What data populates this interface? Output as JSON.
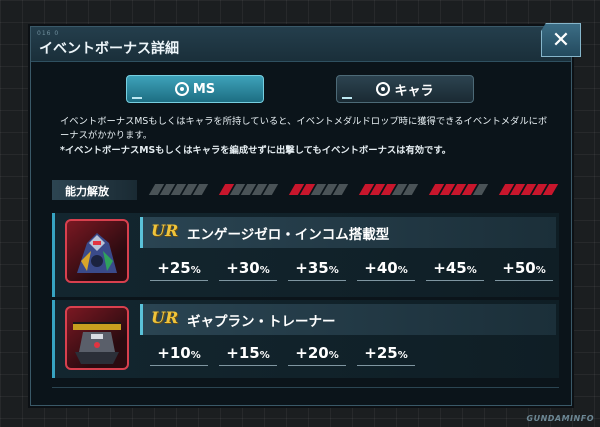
{
  "window": {
    "tag": "016 0",
    "title": "イベントボーナス詳細",
    "close_glyph": "✕"
  },
  "tabs": [
    {
      "label": "MS",
      "active": true
    },
    {
      "label": "キャラ",
      "active": false
    }
  ],
  "notes": {
    "line1": "イベントボーナスMSもしくはキャラを所持していると、イベントメダルドロップ時に獲得できるイベントメダルにボーナスがかかります。",
    "line2": "*イベントボーナスMSもしくはキャラを編成せずに出撃してもイベントボーナスは有効です。"
  },
  "ability": {
    "label": "能力解放",
    "levels": [
      {
        "filled": 0
      },
      {
        "filled": 1
      },
      {
        "filled": 2
      },
      {
        "filled": 3
      },
      {
        "filled": 4
      },
      {
        "filled": 5
      }
    ]
  },
  "units": [
    {
      "rarity": "UR",
      "name": "エンゲージゼロ・インコム搭載型",
      "bonuses": [
        "+25",
        "+30",
        "+35",
        "+40",
        "+45",
        "+50"
      ]
    },
    {
      "rarity": "UR",
      "name": "ギャプラン・トレーナー",
      "bonuses": [
        "+10",
        "+15",
        "+20",
        "+25"
      ]
    }
  ],
  "percent_unit": "%",
  "watermark": "GUNDAMINFO",
  "colors": {
    "accent": "#37a3c1",
    "red": "#c8162c",
    "rarity": "#f0c43a"
  }
}
